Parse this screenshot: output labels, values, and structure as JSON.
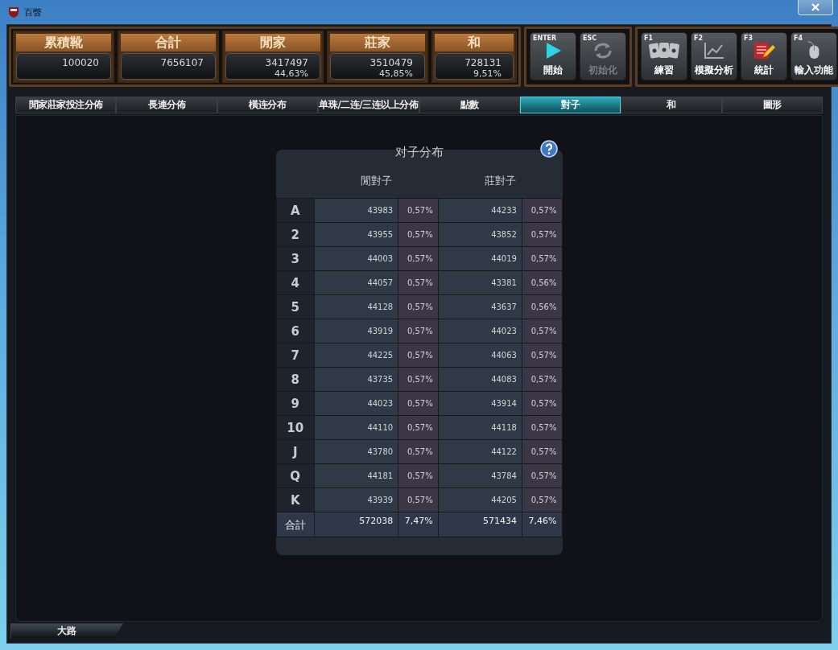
{
  "window": {
    "title": "百瞥"
  },
  "stats": [
    {
      "label": "累積靴",
      "value": "100020"
    },
    {
      "label": "合計",
      "value": "7656107"
    },
    {
      "label": "閒家",
      "value": "3417497",
      "percent": "44,63%"
    },
    {
      "label": "莊家",
      "value": "3510479",
      "percent": "45,85%"
    },
    {
      "label": "和",
      "value": "728131",
      "percent": "9,51%"
    }
  ],
  "actions": [
    {
      "hotkey": "ENTER",
      "label": "開始",
      "kind": "play",
      "disabled": false
    },
    {
      "hotkey": "ESC",
      "label": "初始化",
      "kind": "refresh",
      "disabled": true
    }
  ],
  "functions": [
    {
      "hotkey": "F1",
      "label": "練習",
      "kind": "cards"
    },
    {
      "hotkey": "F2",
      "label": "模擬分析",
      "kind": "chart"
    },
    {
      "hotkey": "F3",
      "label": "統計",
      "kind": "notepad"
    },
    {
      "hotkey": "F4",
      "label": "輸入功能",
      "kind": "mouse"
    }
  ],
  "tabs": [
    {
      "label": "閒家莊家投注分佈",
      "selected": false
    },
    {
      "label": "長連分佈",
      "selected": false
    },
    {
      "label": "橫连分布",
      "selected": false
    },
    {
      "label": "单珠/二连/三连以上分佈",
      "selected": false
    },
    {
      "label": "點數",
      "selected": false
    },
    {
      "label": "對子",
      "selected": true
    },
    {
      "label": "和",
      "selected": false
    },
    {
      "label": "圖形",
      "selected": false
    }
  ],
  "table": {
    "title": "对子分布",
    "columns": [
      "閒對子",
      "莊對子"
    ],
    "rows": [
      {
        "rank": "A",
        "player_count": "43983",
        "player_pct": "0,57%",
        "banker_count": "44233",
        "banker_pct": "0,57%"
      },
      {
        "rank": "2",
        "player_count": "43955",
        "player_pct": "0,57%",
        "banker_count": "43852",
        "banker_pct": "0,57%"
      },
      {
        "rank": "3",
        "player_count": "44003",
        "player_pct": "0,57%",
        "banker_count": "44019",
        "banker_pct": "0,57%"
      },
      {
        "rank": "4",
        "player_count": "44057",
        "player_pct": "0,57%",
        "banker_count": "43381",
        "banker_pct": "0,56%"
      },
      {
        "rank": "5",
        "player_count": "44128",
        "player_pct": "0,57%",
        "banker_count": "43637",
        "banker_pct": "0,56%"
      },
      {
        "rank": "6",
        "player_count": "43919",
        "player_pct": "0,57%",
        "banker_count": "44023",
        "banker_pct": "0,57%"
      },
      {
        "rank": "7",
        "player_count": "44225",
        "player_pct": "0,57%",
        "banker_count": "44063",
        "banker_pct": "0,57%"
      },
      {
        "rank": "8",
        "player_count": "43735",
        "player_pct": "0,57%",
        "banker_count": "44083",
        "banker_pct": "0,57%"
      },
      {
        "rank": "9",
        "player_count": "44023",
        "player_pct": "0,57%",
        "banker_count": "43914",
        "banker_pct": "0,57%"
      },
      {
        "rank": "10",
        "player_count": "44110",
        "player_pct": "0,57%",
        "banker_count": "44118",
        "banker_pct": "0,57%"
      },
      {
        "rank": "J",
        "player_count": "43780",
        "player_pct": "0,57%",
        "banker_count": "44122",
        "banker_pct": "0,57%"
      },
      {
        "rank": "Q",
        "player_count": "44181",
        "player_pct": "0,57%",
        "banker_count": "43784",
        "banker_pct": "0,57%"
      },
      {
        "rank": "K",
        "player_count": "43939",
        "player_pct": "0,57%",
        "banker_count": "44205",
        "banker_pct": "0,57%"
      }
    ],
    "total": {
      "rank": "合計",
      "player_count": "572038",
      "player_pct": "7,47%",
      "banker_count": "571434",
      "banker_pct": "7,46%"
    }
  },
  "bottom_tabs": [
    {
      "label": "大路",
      "selected": true
    }
  ]
}
